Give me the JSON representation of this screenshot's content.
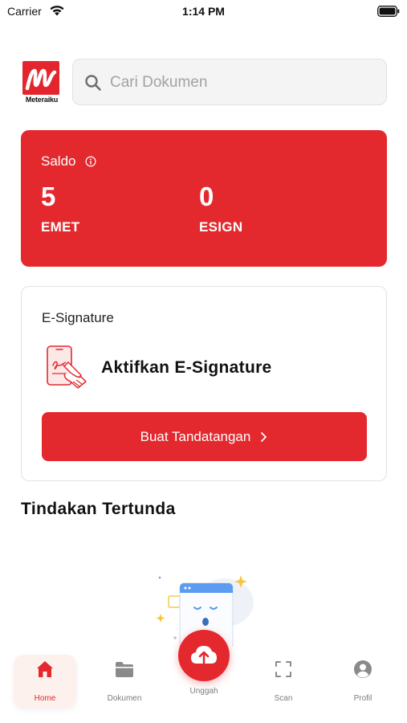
{
  "status_bar": {
    "carrier": "Carrier",
    "time": "1:14 PM"
  },
  "header": {
    "logo_text": "Meteraiku",
    "search_placeholder": "Cari Dokumen"
  },
  "balance": {
    "title": "Saldo",
    "items": [
      {
        "value": "5",
        "label": "EMET"
      },
      {
        "value": "0",
        "label": "ESIGN"
      }
    ]
  },
  "esignature": {
    "title": "E-Signature",
    "cta_text": "Aktifkan E-Signature",
    "button_label": "Buat Tandatangan"
  },
  "pending": {
    "title": "Tindakan Tertunda"
  },
  "bottom_nav": {
    "items": [
      {
        "label": "Home",
        "icon": "home-icon",
        "active": true
      },
      {
        "label": "Dokumen",
        "icon": "folder-icon",
        "active": false
      },
      {
        "label": "Unggah",
        "icon": "cloud-upload-icon",
        "active": false
      },
      {
        "label": "Scan",
        "icon": "scan-icon",
        "active": false
      },
      {
        "label": "Profil",
        "icon": "profile-icon",
        "active": false
      }
    ]
  },
  "colors": {
    "brand": "#e3292e",
    "active_nav_bg": "#fdf1ee",
    "muted_text": "#7c7c7c"
  }
}
